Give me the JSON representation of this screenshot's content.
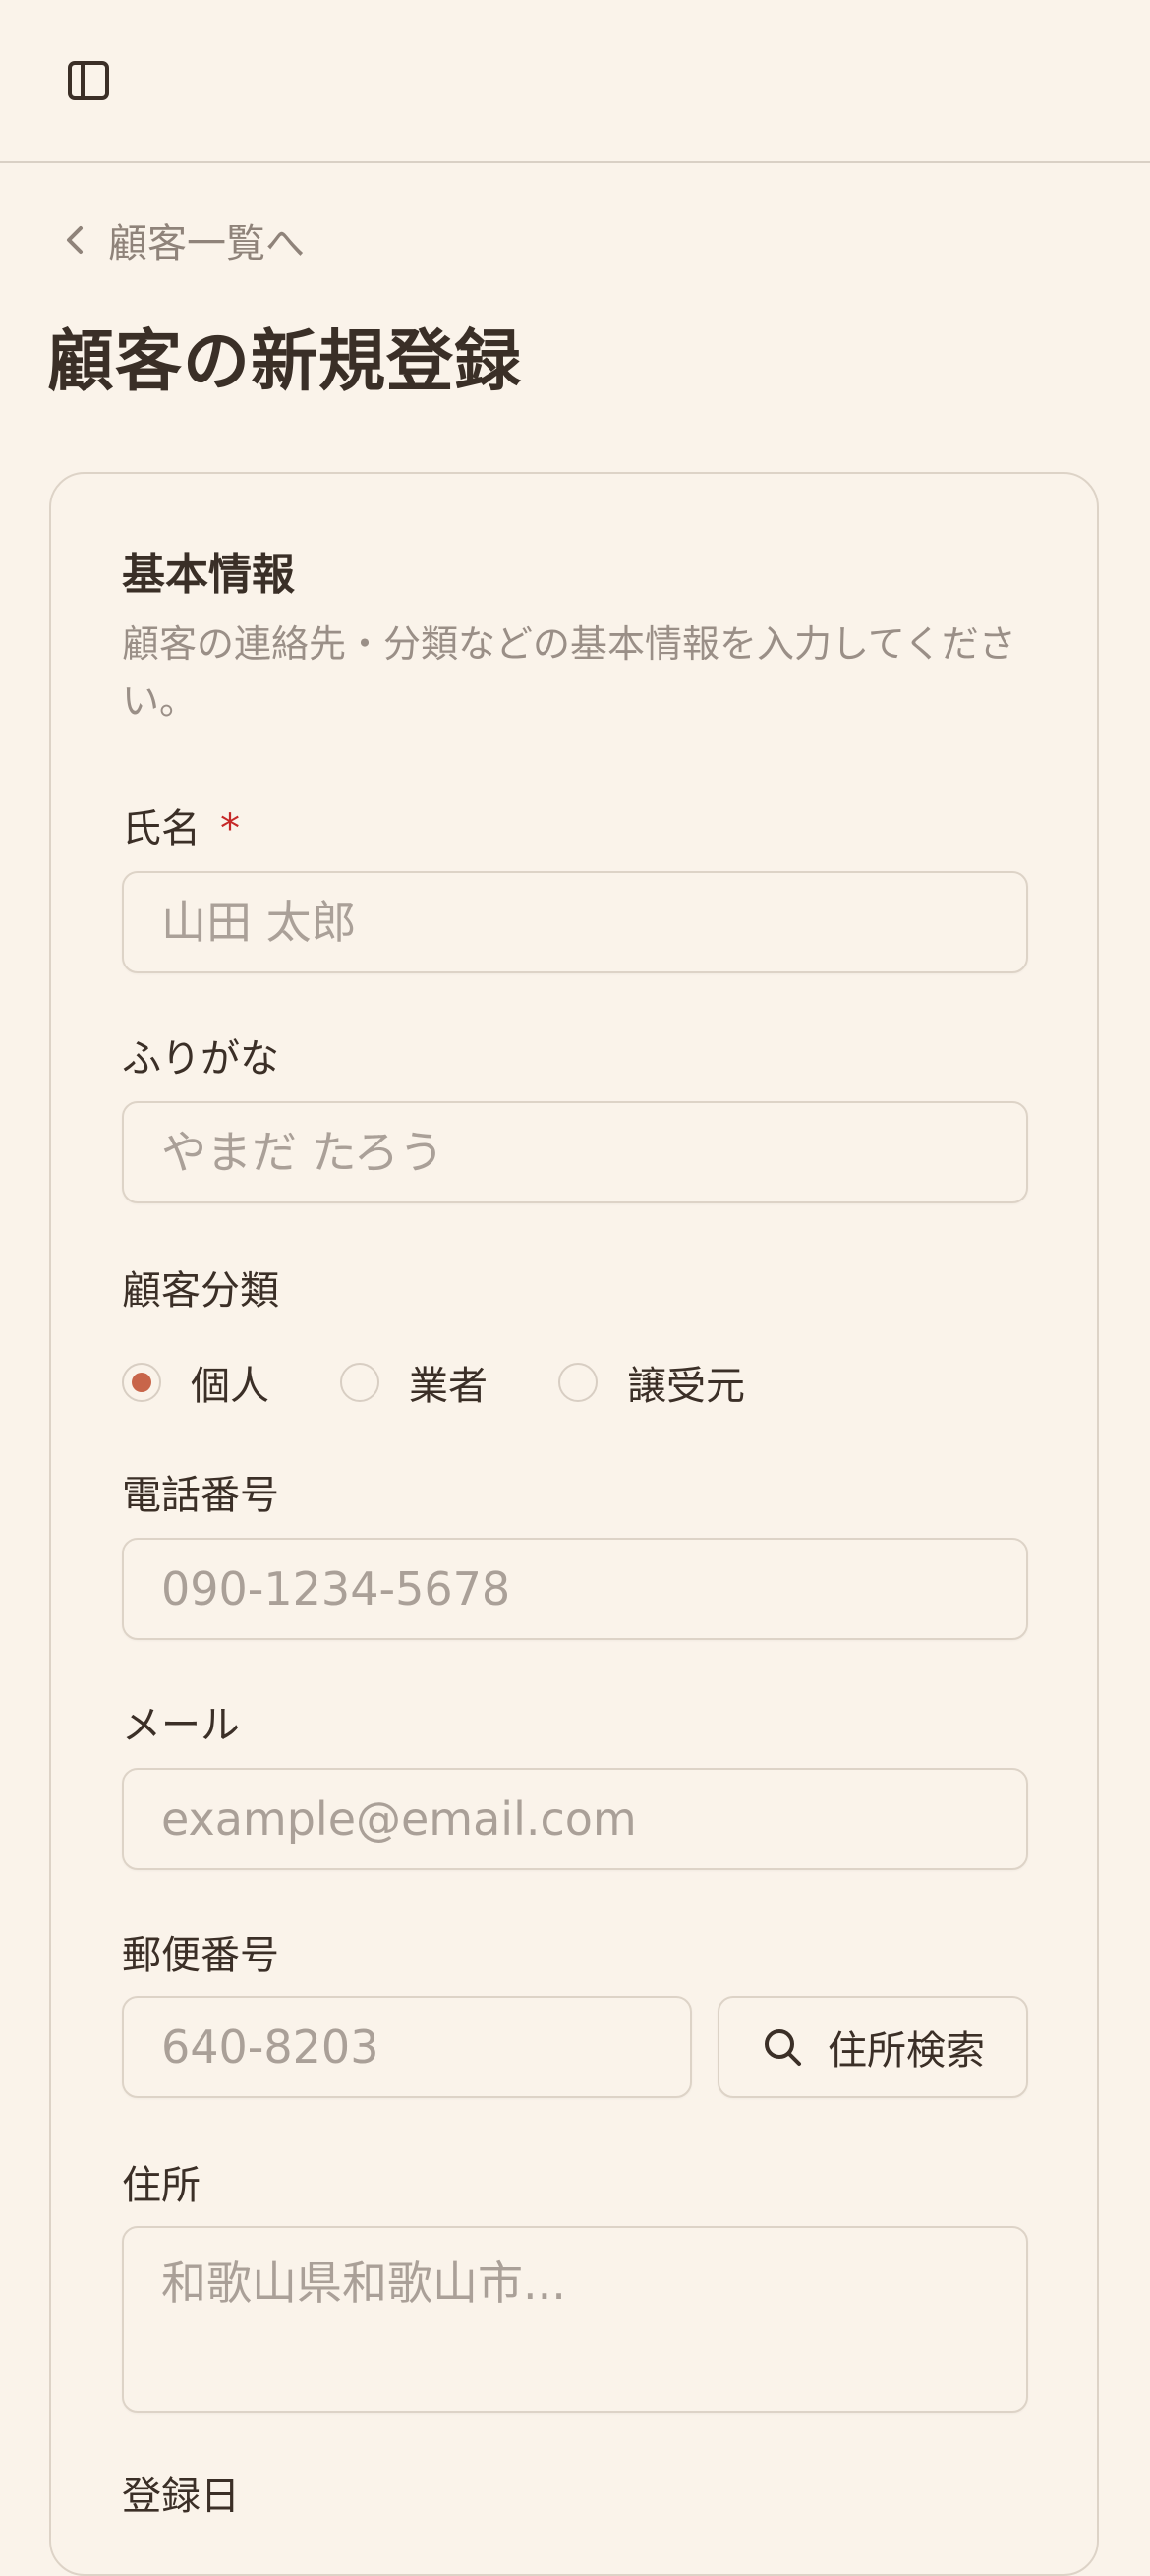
{
  "topbar": {
    "sidebar_toggle_icon": "sidebar-toggle-icon"
  },
  "nav": {
    "back_label": "顧客一覧へ",
    "back_icon": "chevron-left-icon"
  },
  "page": {
    "title": "顧客の新規登録"
  },
  "section": {
    "title": "基本情報",
    "description": "顧客の連絡先・分類などの基本情報を入力してください。"
  },
  "fields": {
    "name": {
      "label": "氏名",
      "required_mark": "*",
      "placeholder": "山田 太郎",
      "value": ""
    },
    "furigana": {
      "label": "ふりがな",
      "placeholder": "やまだ たろう",
      "value": ""
    },
    "category": {
      "label": "顧客分類",
      "options": [
        "個人",
        "業者",
        "譲受元"
      ],
      "selected": "個人"
    },
    "phone": {
      "label": "電話番号",
      "placeholder": "090-1234-5678",
      "value": ""
    },
    "email": {
      "label": "メール",
      "placeholder": "example@email.com",
      "value": ""
    },
    "postal": {
      "label": "郵便番号",
      "placeholder": "640-8203",
      "value": "",
      "search_button_label": "住所検索",
      "search_icon": "search-icon"
    },
    "address": {
      "label": "住所",
      "placeholder": "和歌山県和歌山市...",
      "value": ""
    },
    "registered_date": {
      "label": "登録日"
    }
  },
  "colors": {
    "background": "#faf3ea",
    "accent": "#c8654a",
    "required": "#c62828",
    "text": "#3b2f27",
    "muted": "#9a8f87",
    "border": "#ddd3c7"
  }
}
